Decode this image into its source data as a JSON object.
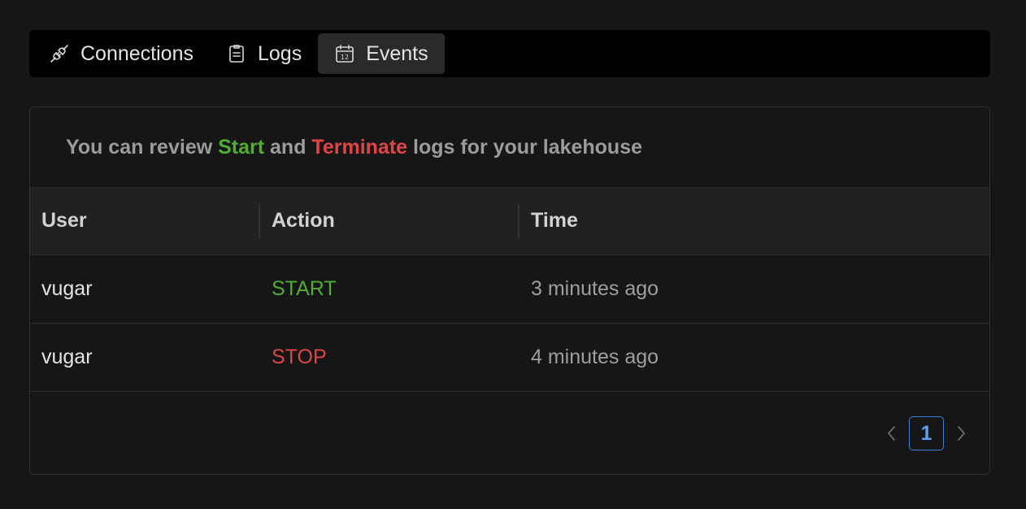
{
  "tabs": [
    {
      "label": "Connections",
      "icon": "plug-icon",
      "active": false
    },
    {
      "label": "Logs",
      "icon": "clipboard-icon",
      "active": false
    },
    {
      "label": "Events",
      "icon": "calendar-icon",
      "active": true
    }
  ],
  "intro": {
    "prefix": "You can review ",
    "start_word": "Start",
    "and_word": " and ",
    "terminate_word": "Terminate",
    "suffix": " logs for your lakehouse"
  },
  "table": {
    "headers": [
      "User",
      "Action",
      "Time"
    ],
    "rows": [
      {
        "user": "vugar",
        "action": "START",
        "time": "3 minutes ago"
      },
      {
        "user": "vugar",
        "action": "STOP",
        "time": "4 minutes ago"
      }
    ]
  },
  "pagination": {
    "current_page": "1"
  },
  "colors": {
    "start": "#4fae2f",
    "stop": "#e04545",
    "accent": "#3b7fd6"
  }
}
